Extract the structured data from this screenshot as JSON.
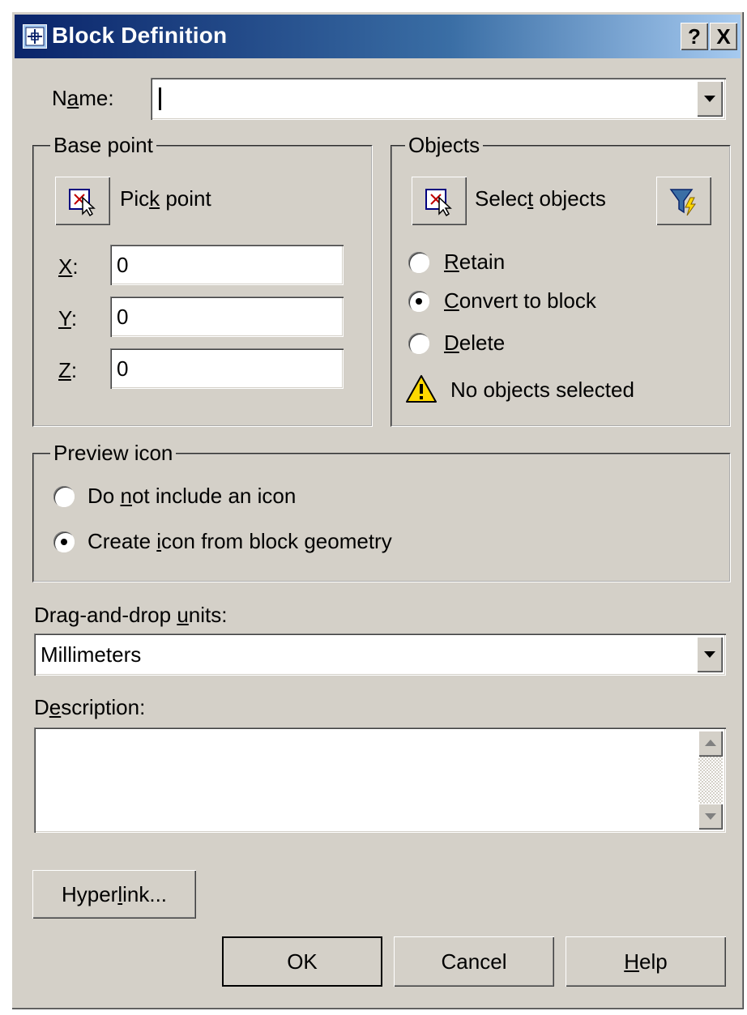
{
  "window": {
    "title": "Block Definition",
    "help_button": "?",
    "close_button": "X"
  },
  "name_field": {
    "label_pre": "N",
    "label_u": "a",
    "label_post": "me:",
    "value": ""
  },
  "base_point": {
    "legend": "Base point",
    "pick_label_pre": "Pic",
    "pick_label_u": "k",
    "pick_label_post": " point",
    "x_label": "X",
    "y_label": "Y",
    "z_label": "Z",
    "colon": ":",
    "x_value": "0",
    "y_value": "0",
    "z_value": "0"
  },
  "objects": {
    "legend": "Objects",
    "select_label_pre": "Selec",
    "select_label_u": "t",
    "select_label_post": " objects",
    "retain_u": "R",
    "retain_rest": "etain",
    "convert_u": "C",
    "convert_rest": "onvert to block",
    "delete_u": "D",
    "delete_rest": "elete",
    "selected_option": "Convert to block",
    "status": "No objects selected"
  },
  "preview_icon": {
    "legend": "Preview icon",
    "opt1_pre": "Do ",
    "opt1_u": "n",
    "opt1_post": "ot include an icon",
    "opt2_pre": "Create ",
    "opt2_u": "i",
    "opt2_post": "con from block geometry",
    "selected_option": "Create icon from block geometry"
  },
  "units": {
    "label_pre": "Drag-and-drop ",
    "label_u": "u",
    "label_post": "nits:",
    "value": "Millimeters"
  },
  "description": {
    "label_pre": "D",
    "label_u": "e",
    "label_post": "scription:",
    "value": ""
  },
  "buttons": {
    "hyperlink_pre": "Hyper",
    "hyperlink_u": "l",
    "hyperlink_post": "ink...",
    "ok": "OK",
    "cancel": "Cancel",
    "help_u": "H",
    "help_rest": "elp"
  },
  "colors": {
    "dialog_bg": "#d4d0c8",
    "titlebar_start": "#0a246a",
    "titlebar_end": "#a6caf0",
    "warning": "#ffd800"
  }
}
